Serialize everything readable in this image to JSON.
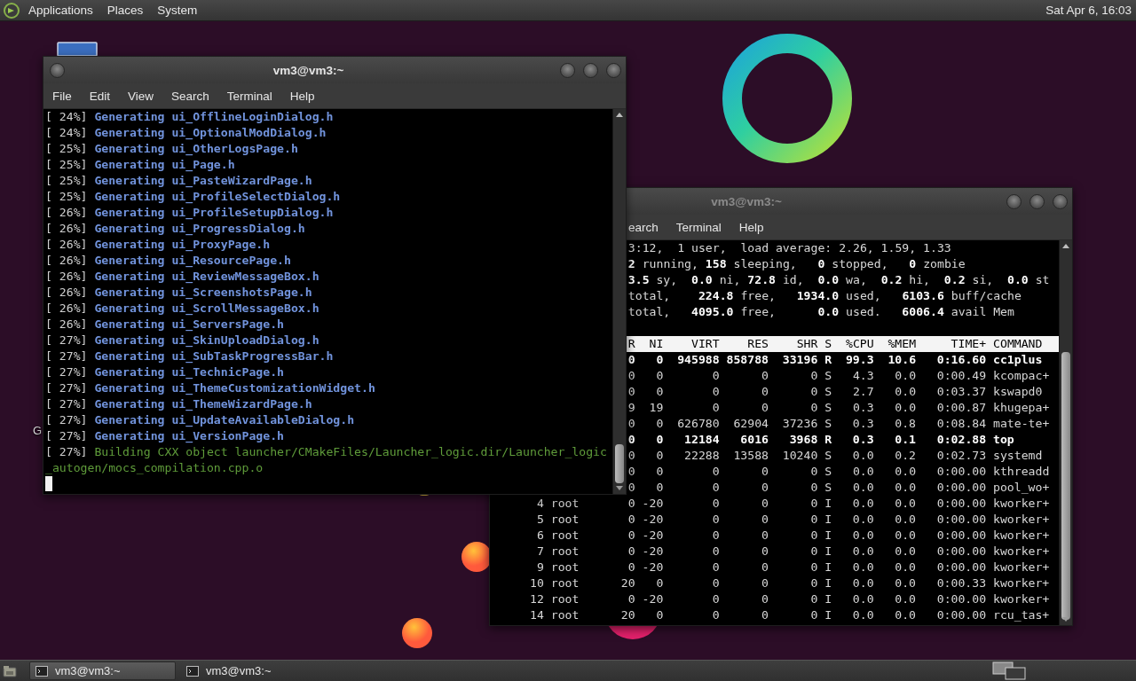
{
  "top_panel": {
    "menus": [
      "Applications",
      "Places",
      "System"
    ],
    "clock": "Sat Apr 6, 16:03"
  },
  "desktop": {
    "label_fragment": "G"
  },
  "windows": [
    {
      "title": "vm3@vm3:~",
      "active": true,
      "menu": [
        "File",
        "Edit",
        "View",
        "Search",
        "Terminal",
        "Help"
      ],
      "lines": [
        {
          "progress": "[ 24%]",
          "message": "Generating ui_OfflineLoginDialog.h",
          "kind": "generate"
        },
        {
          "progress": "[ 24%]",
          "message": "Generating ui_OptionalModDialog.h",
          "kind": "generate"
        },
        {
          "progress": "[ 25%]",
          "message": "Generating ui_OtherLogsPage.h",
          "kind": "generate"
        },
        {
          "progress": "[ 25%]",
          "message": "Generating ui_Page.h",
          "kind": "generate"
        },
        {
          "progress": "[ 25%]",
          "message": "Generating ui_PasteWizardPage.h",
          "kind": "generate"
        },
        {
          "progress": "[ 25%]",
          "message": "Generating ui_ProfileSelectDialog.h",
          "kind": "generate"
        },
        {
          "progress": "[ 26%]",
          "message": "Generating ui_ProfileSetupDialog.h",
          "kind": "generate"
        },
        {
          "progress": "[ 26%]",
          "message": "Generating ui_ProgressDialog.h",
          "kind": "generate"
        },
        {
          "progress": "[ 26%]",
          "message": "Generating ui_ProxyPage.h",
          "kind": "generate"
        },
        {
          "progress": "[ 26%]",
          "message": "Generating ui_ResourcePage.h",
          "kind": "generate"
        },
        {
          "progress": "[ 26%]",
          "message": "Generating ui_ReviewMessageBox.h",
          "kind": "generate"
        },
        {
          "progress": "[ 26%]",
          "message": "Generating ui_ScreenshotsPage.h",
          "kind": "generate"
        },
        {
          "progress": "[ 26%]",
          "message": "Generating ui_ScrollMessageBox.h",
          "kind": "generate"
        },
        {
          "progress": "[ 26%]",
          "message": "Generating ui_ServersPage.h",
          "kind": "generate"
        },
        {
          "progress": "[ 27%]",
          "message": "Generating ui_SkinUploadDialog.h",
          "kind": "generate"
        },
        {
          "progress": "[ 27%]",
          "message": "Generating ui_SubTaskProgressBar.h",
          "kind": "generate"
        },
        {
          "progress": "[ 27%]",
          "message": "Generating ui_TechnicPage.h",
          "kind": "generate"
        },
        {
          "progress": "[ 27%]",
          "message": "Generating ui_ThemeCustomizationWidget.h",
          "kind": "generate"
        },
        {
          "progress": "[ 27%]",
          "message": "Generating ui_ThemeWizardPage.h",
          "kind": "generate"
        },
        {
          "progress": "[ 27%]",
          "message": "Generating ui_UpdateAvailableDialog.h",
          "kind": "generate"
        },
        {
          "progress": "[ 27%]",
          "message": "Generating ui_VersionPage.h",
          "kind": "generate"
        },
        {
          "progress": "[ 27%]",
          "message": "Building CXX object launcher/CMakeFiles/Launcher_logic.dir/Launcher_logic_autogen/mocs_compilation.cpp.o",
          "kind": "build"
        }
      ]
    },
    {
      "title": "vm3@vm3:~",
      "active": false,
      "menu": [
        "earch",
        "Terminal",
        "Help"
      ],
      "summary": [
        "3:12,  1 user,  load average: 2.26, 1.59, 1.33",
        "**2** running, **158** sleeping,   **0** stopped,   **0** zombie",
        "**3.5** sy,  **0.0** ni, **72.8** id,  **0.0** wa,  **0.2** hi,  **0.2** si,  **0.0** st",
        "total,    **224.8** free,   **1934.0** used,   **6103.6** buff/cache",
        "total,   **4095.0** free,      **0.0** used.   **6006.4** avail Mem"
      ],
      "columns": [
        "R",
        "NI",
        "VIRT",
        "RES",
        "SHR",
        "S",
        "%CPU",
        "%MEM",
        "TIME+",
        "COMMAND"
      ],
      "rows": [
        {
          "cells": [
            "0",
            "0",
            "945988",
            "858788",
            "33196",
            "R",
            "99.3",
            "10.6",
            "0:16.60",
            "cc1plus"
          ],
          "emphasized": true
        },
        {
          "cells": [
            "0",
            "0",
            "0",
            "0",
            "0",
            "S",
            "4.3",
            "0.0",
            "0:00.49",
            "kcompac+"
          ],
          "emphasized": false
        },
        {
          "cells": [
            "0",
            "0",
            "0",
            "0",
            "0",
            "S",
            "2.7",
            "0.0",
            "0:03.37",
            "kswapd0"
          ],
          "emphasized": false
        },
        {
          "cells": [
            "9",
            "19",
            "0",
            "0",
            "0",
            "S",
            "0.3",
            "0.0",
            "0:00.87",
            "khugepa+"
          ],
          "emphasized": false
        },
        {
          "cells": [
            "0",
            "0",
            "626780",
            "62904",
            "37236",
            "S",
            "0.3",
            "0.8",
            "0:08.84",
            "mate-te+"
          ],
          "emphasized": false
        },
        {
          "cells": [
            "0",
            "0",
            "12184",
            "6016",
            "3968",
            "R",
            "0.3",
            "0.1",
            "0:02.88",
            "top"
          ],
          "emphasized": true
        },
        {
          "cells": [
            "0",
            "0",
            "22288",
            "13588",
            "10240",
            "S",
            "0.0",
            "0.2",
            "0:02.73",
            "systemd"
          ],
          "emphasized": false
        },
        {
          "cells": [
            "0",
            "0",
            "0",
            "0",
            "0",
            "S",
            "0.0",
            "0.0",
            "0:00.00",
            "kthreadd"
          ],
          "emphasized": false
        },
        {
          "cells": [
            "0",
            "0",
            "0",
            "0",
            "0",
            "S",
            "0.0",
            "0.0",
            "0:00.00",
            "pool_wo+"
          ],
          "emphasized": false
        },
        {
          "cells": [
            "4",
            "root",
            "0",
            "-20",
            "0",
            "0",
            "0",
            "I",
            "0.0",
            "0.0",
            "0:00.00",
            "kworker+"
          ],
          "emphasized": false
        },
        {
          "cells": [
            "5",
            "root",
            "0",
            "-20",
            "0",
            "0",
            "0",
            "I",
            "0.0",
            "0.0",
            "0:00.00",
            "kworker+"
          ],
          "emphasized": false
        },
        {
          "cells": [
            "6",
            "root",
            "0",
            "-20",
            "0",
            "0",
            "0",
            "I",
            "0.0",
            "0.0",
            "0:00.00",
            "kworker+"
          ],
          "emphasized": false
        },
        {
          "cells": [
            "7",
            "root",
            "0",
            "-20",
            "0",
            "0",
            "0",
            "I",
            "0.0",
            "0.0",
            "0:00.00",
            "kworker+"
          ],
          "emphasized": false
        },
        {
          "cells": [
            "9",
            "root",
            "0",
            "-20",
            "0",
            "0",
            "0",
            "I",
            "0.0",
            "0.0",
            "0:00.00",
            "kworker+"
          ],
          "emphasized": false
        },
        {
          "cells": [
            "10",
            "root",
            "20",
            "0",
            "0",
            "0",
            "0",
            "I",
            "0.0",
            "0.0",
            "0:00.33",
            "kworker+"
          ],
          "emphasized": false
        },
        {
          "cells": [
            "12",
            "root",
            "0",
            "-20",
            "0",
            "0",
            "0",
            "I",
            "0.0",
            "0.0",
            "0:00.00",
            "kworker+"
          ],
          "emphasized": false
        },
        {
          "cells": [
            "14",
            "root",
            "20",
            "0",
            "0",
            "0",
            "0",
            "I",
            "0.0",
            "0.0",
            "0:00.00",
            "rcu_tas+"
          ],
          "emphasized": false
        }
      ]
    }
  ],
  "taskbar": {
    "tasks": [
      {
        "label": "vm3@vm3:~",
        "selected": true
      },
      {
        "label": "vm3@vm3:~",
        "selected": false
      }
    ]
  }
}
